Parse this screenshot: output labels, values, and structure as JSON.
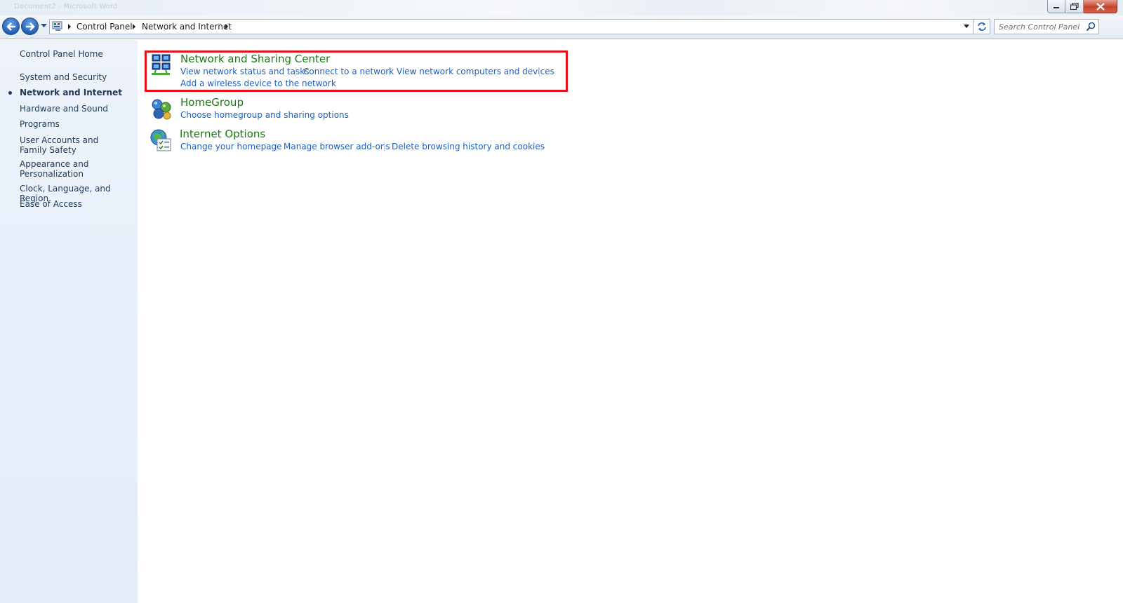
{
  "window": {
    "title_ghost": "Document2 - Microsoft Word"
  },
  "address": {
    "breadcrumbs": [
      "Control Panel",
      "Network and Internet"
    ],
    "search_placeholder": "Search Control Panel"
  },
  "sidebar": {
    "home": "Control Panel Home",
    "items": [
      {
        "label": "System and Security"
      },
      {
        "label": "Network and Internet",
        "current": true
      },
      {
        "label": "Hardware and Sound"
      },
      {
        "label": "Programs"
      },
      {
        "label": "User Accounts and Family Safety"
      },
      {
        "label": "Appearance and Personalization"
      },
      {
        "label": "Clock, Language, and Region"
      },
      {
        "label": "Ease of Access"
      }
    ]
  },
  "categories": [
    {
      "title": "Network and Sharing Center",
      "icon": "network-sharing-icon",
      "links": [
        "View network status and tasks",
        "Connect to a network",
        "View network computers and devices",
        "Add a wireless device to the network"
      ]
    },
    {
      "title": "HomeGroup",
      "icon": "homegroup-icon",
      "links": [
        "Choose homegroup and sharing options"
      ]
    },
    {
      "title": "Internet Options",
      "icon": "internet-options-icon",
      "links": [
        "Change your homepage",
        "Manage browser add-ons",
        "Delete browsing history and cookies"
      ]
    }
  ],
  "colors": {
    "category_title": "#1a7a12",
    "task_link": "#1c5fbf",
    "highlight": "#e3121b",
    "sidebar_text": "#1e395b"
  }
}
